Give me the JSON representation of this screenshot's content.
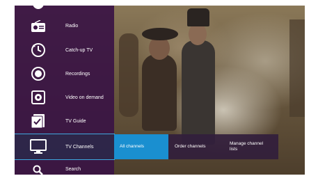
{
  "menu": {
    "items": [
      {
        "label": "",
        "icon": "top-item-icon"
      },
      {
        "label": "Radio",
        "icon": "radio-icon"
      },
      {
        "label": "Catch-up TV",
        "icon": "catch-up-icon"
      },
      {
        "label": "Recordings",
        "icon": "record-icon"
      },
      {
        "label": "Video on demand",
        "icon": "video-on-demand-icon"
      },
      {
        "label": "TV Guide",
        "icon": "tv-guide-icon"
      },
      {
        "label": "TV Channels",
        "icon": "tv-icon",
        "selected": true
      },
      {
        "label": "Search",
        "icon": "search-icon"
      }
    ]
  },
  "submenu": {
    "items": [
      {
        "label": "All channels",
        "active": true
      },
      {
        "label": "Order channels"
      },
      {
        "label": "Manage channel lists"
      }
    ]
  },
  "colors": {
    "menu_bg": "#3a1444",
    "accent": "#1a8fd0",
    "selection_outline": "#3fa8e0"
  }
}
